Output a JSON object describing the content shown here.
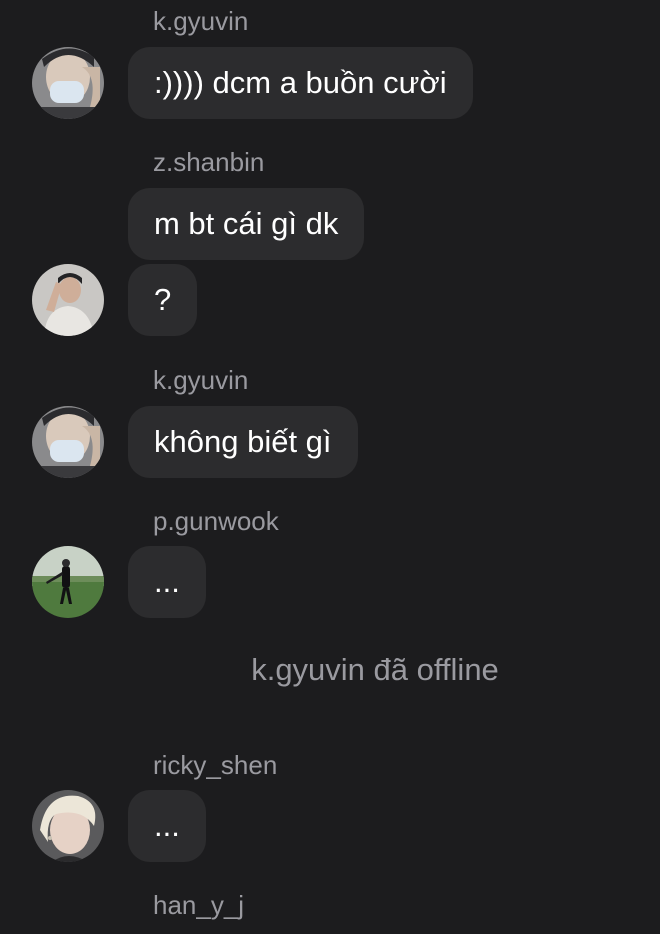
{
  "messages": [
    {
      "sender": "k.gyuvin",
      "text": ":)))) dcm a buồn cười",
      "avatar": "masked-person-avatar"
    },
    {
      "sender": "z.shanbin",
      "text": "m bt cái gì dk"
    },
    {
      "text": "?",
      "avatar": "posing-person-avatar"
    },
    {
      "sender": "k.gyuvin",
      "text": "không biết gì",
      "avatar": "masked-person-avatar"
    },
    {
      "sender": "p.gunwook",
      "text": "...",
      "avatar": "field-player-avatar"
    },
    {
      "system": "k.gyuvin đã offline"
    },
    {
      "sender": "ricky_shen",
      "text": "...",
      "avatar": "blonde-person-avatar"
    },
    {
      "sender": "han_y_j"
    }
  ],
  "colors": {
    "background": "#1c1c1e",
    "bubble": "#2c2c2e",
    "name_text": "#9a9aa0",
    "message_text": "#ffffff"
  }
}
